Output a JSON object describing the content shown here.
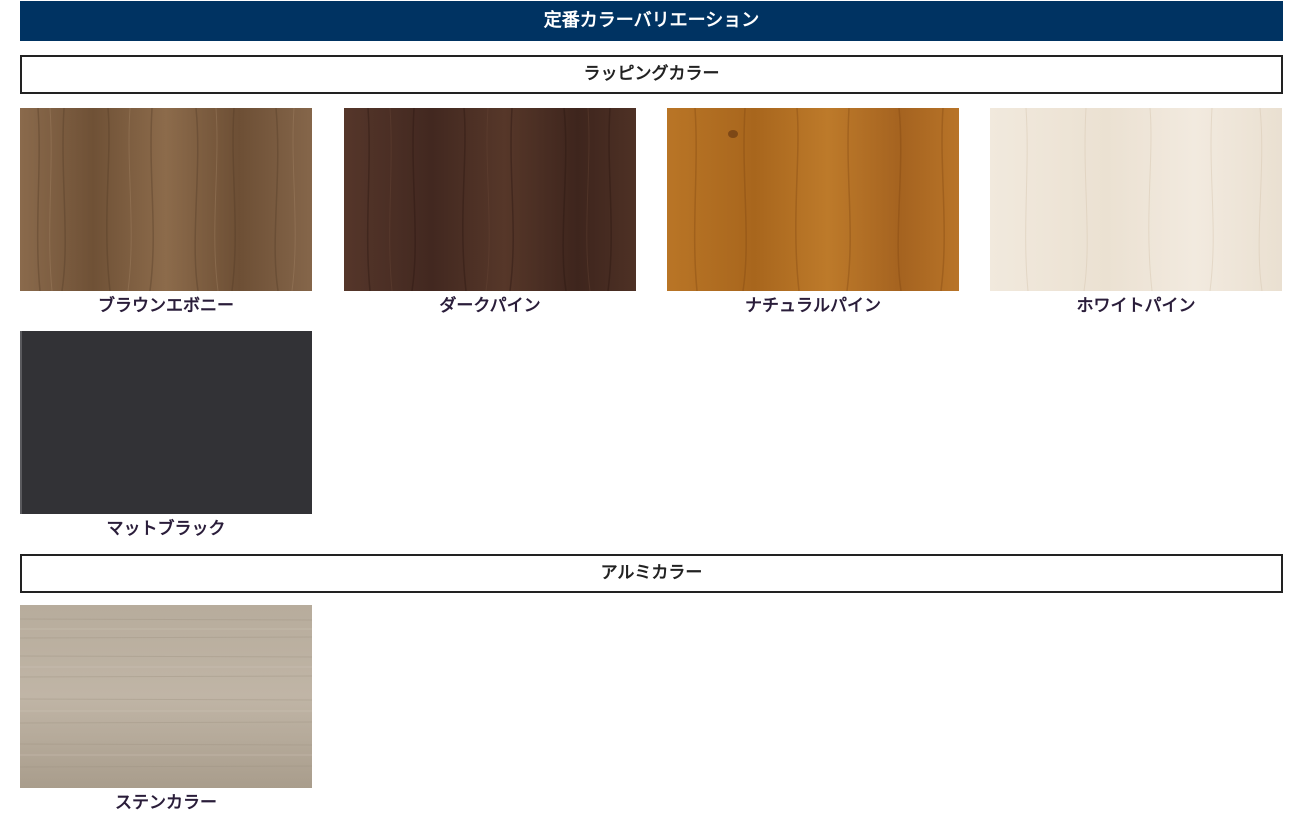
{
  "header": {
    "title": "定番カラーバリエーション"
  },
  "sections": [
    {
      "title": "ラッピングカラー",
      "items": [
        {
          "label": "ブラウンエボニー",
          "color": "#7a5a3e"
        },
        {
          "label": "ダークパイン",
          "color": "#4a2e22"
        },
        {
          "label": "ナチュラルパイン",
          "color": "#b47022"
        },
        {
          "label": "ホワイトパイン",
          "color": "#efe6d9"
        },
        {
          "label": "マットブラック",
          "color": "#323236"
        }
      ]
    },
    {
      "title": "アルミカラー",
      "items": [
        {
          "label": "ステンカラー",
          "color": "#b1a595"
        }
      ]
    }
  ]
}
